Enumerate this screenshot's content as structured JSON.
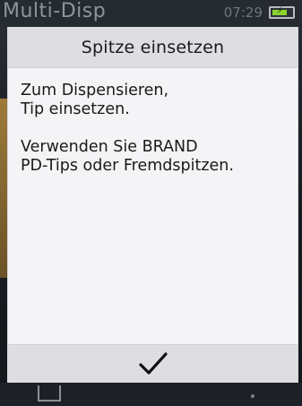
{
  "background": {
    "app_title": "Multi-Disp",
    "clock": "07:29",
    "battery_icon": "battery-charging-icon",
    "battery_level": 0.75,
    "colors": {
      "battery": "#8bd22f",
      "accent_left": "#9e7a3a"
    }
  },
  "dialog": {
    "title": "Spitze einsetzen",
    "paragraphs": [
      {
        "line1": "Zum Dispensieren,",
        "line2": "Tip einsetzen."
      },
      {
        "line1": "Verwenden Sie BRAND",
        "line2": "PD-Tips oder Fremdspitzen."
      }
    ],
    "confirm_icon": "checkmark-icon"
  }
}
